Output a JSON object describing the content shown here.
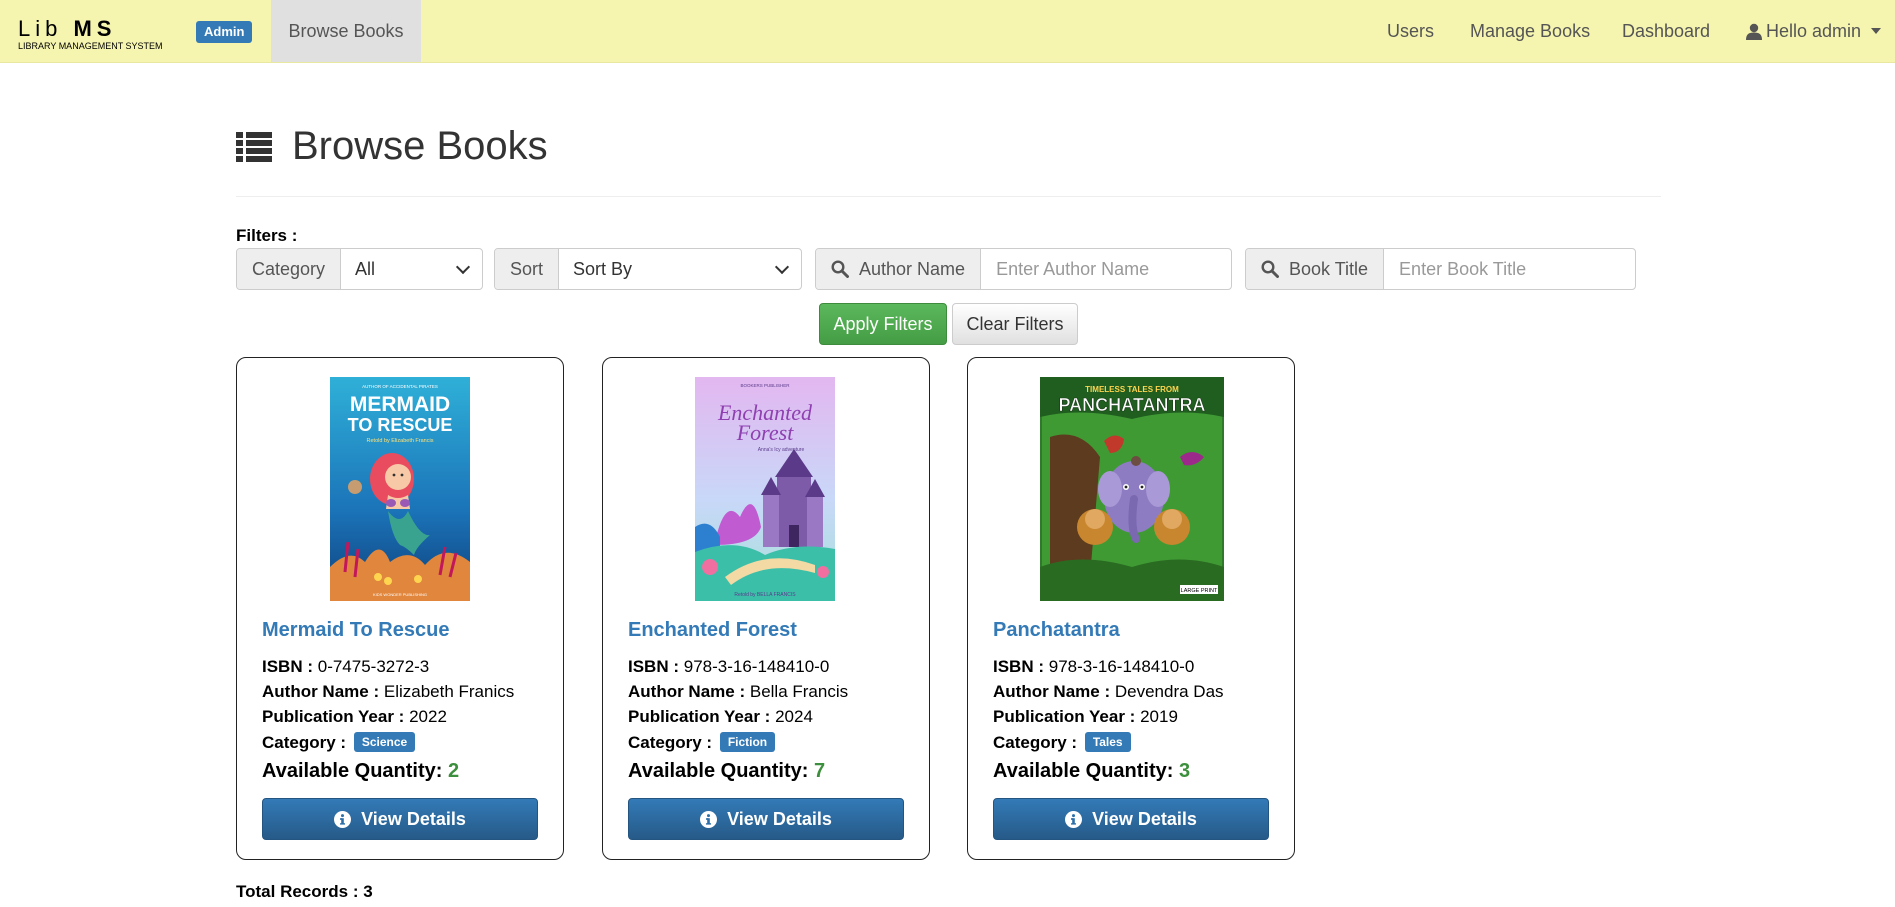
{
  "nav": {
    "brand_main_prefix": "Lib ",
    "brand_main_bold": "MS",
    "brand_sub": "LIBRARY MANAGEMENT SYSTEM",
    "role_badge": "Admin",
    "active_item": "Browse Books",
    "users": "Users",
    "manage_books": "Manage Books",
    "dashboard": "Dashboard",
    "user_greeting": "Hello admin"
  },
  "page": {
    "title": "Browse Books"
  },
  "filters": {
    "label": "Filters :",
    "category_label": "Category",
    "category_value": "All",
    "sort_label": "Sort",
    "sort_value": "Sort By",
    "author_label": "Author Name",
    "author_placeholder": "Enter Author Name",
    "title_label": "Book Title",
    "title_placeholder": "Enter Book Title",
    "apply_button": "Apply Filters",
    "clear_button": "Clear Filters"
  },
  "books": [
    {
      "title": "Mermaid To Rescue",
      "isbn": "0-7475-3272-3",
      "author": "Elizabeth Franics",
      "year": "2022",
      "category": "Science",
      "quantity": "2",
      "cover": {
        "top_small": "AUTHOR OF ACCIDENTAL PIRATES",
        "line1": "MERMAID",
        "line2": "TO RESCUE",
        "byline": "Retold by Elizabeth Francis",
        "bottom": "KIDS WONDER PUBLISHING"
      }
    },
    {
      "title": "Enchanted Forest",
      "isbn": "978-3-16-148410-0",
      "author": "Bella Francis",
      "year": "2024",
      "category": "Fiction",
      "quantity": "7",
      "cover": {
        "top_small": "BOOKERS PUBLISHER",
        "line1": "Enchanted",
        "line2": "Forest",
        "byline": "Anna's Icy adventure",
        "bottom": "Retold by BELLA FRANCIS"
      }
    },
    {
      "title": "Panchatantra",
      "isbn": "978-3-16-148410-0",
      "author": "Devendra Das",
      "year": "2019",
      "category": "Tales",
      "quantity": "3",
      "cover": {
        "top_small": "TIMELESS TALES FROM",
        "line1": "PANCHATANTRA",
        "bottom": "LARGE PRINT"
      }
    }
  ],
  "labels": {
    "isbn": "ISBN :",
    "author": "Author Name :",
    "year": "Publication Year :",
    "category": "Category :",
    "quantity": "Available Quantity:",
    "view_details": "View Details",
    "total_records_label": "Total Records :",
    "total_records_value": "3"
  },
  "colors": {
    "navbar_bg": "#f5f5b0",
    "primary": "#337ab7",
    "success": "#5cb85c",
    "quantity_green": "#3c8f3c"
  },
  "icons": [
    "list-icon",
    "search-icon",
    "user-icon",
    "info-circle-icon"
  ]
}
